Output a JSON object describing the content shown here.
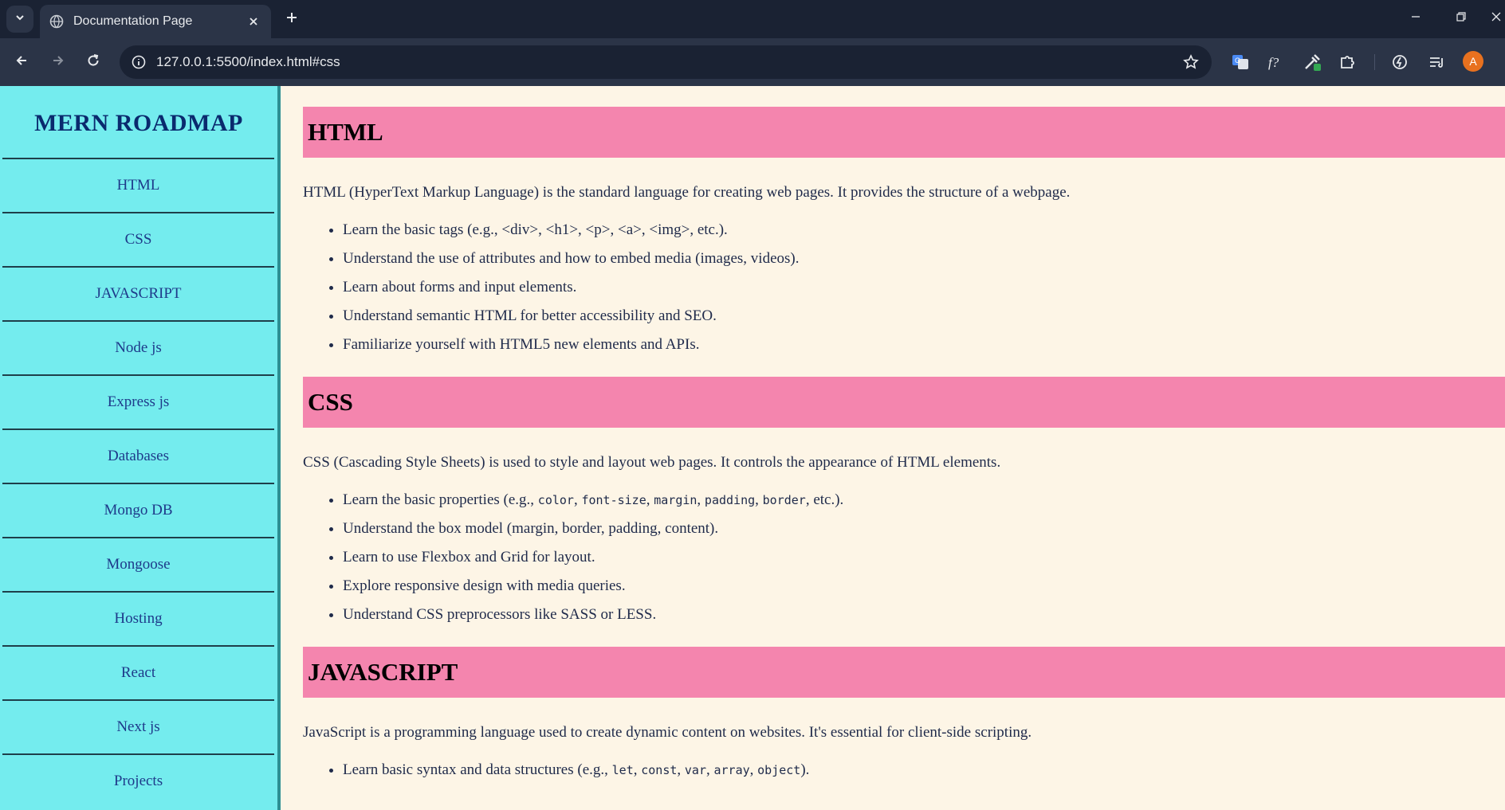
{
  "browser": {
    "tab_title": "Documentation Page",
    "url": "127.0.0.1:5500/index.html#css",
    "avatar_letter": "A",
    "accent_color": "#e8711f"
  },
  "sidebar": {
    "brand": "MERN ROADMAP",
    "items": [
      {
        "label": "HTML"
      },
      {
        "label": "CSS"
      },
      {
        "label": "JAVASCRIPT"
      },
      {
        "label": "Node js"
      },
      {
        "label": "Express js"
      },
      {
        "label": "Databases"
      },
      {
        "label": "Mongo DB"
      },
      {
        "label": "Mongoose"
      },
      {
        "label": "Hosting"
      },
      {
        "label": "React"
      },
      {
        "label": "Next js"
      },
      {
        "label": "Projects"
      }
    ]
  },
  "sections": [
    {
      "title": "HTML",
      "lead": "HTML (HyperText Markup Language) is the standard language for creating web pages. It provides the structure of a webpage.",
      "bullets": [
        "Learn the basic tags (e.g., <div>, <h1>, <p>, <a>, <img>, etc.).",
        "Understand the use of attributes and how to embed media (images, videos).",
        "Learn about forms and input elements.",
        "Understand semantic HTML for better accessibility and SEO.",
        "Familiarize yourself with HTML5 new elements and APIs."
      ]
    },
    {
      "title": "CSS",
      "lead": "CSS (Cascading Style Sheets) is used to style and layout web pages. It controls the appearance of HTML elements.",
      "bullet_props": {
        "prefix": "Learn the basic properties (e.g., ",
        "codes": [
          "color",
          "font-size",
          "margin",
          "padding",
          "border"
        ],
        "suffix": ", etc.)."
      },
      "bullets": [
        "Understand the box model (margin, border, padding, content).",
        "Learn to use Flexbox and Grid for layout.",
        "Explore responsive design with media queries.",
        "Understand CSS preprocessors like SASS or LESS."
      ]
    },
    {
      "title": "JAVASCRIPT",
      "lead": "JavaScript is a programming language used to create dynamic content on websites. It's essential for client-side scripting.",
      "bullet_syntax": {
        "prefix": "Learn basic syntax and data structures (e.g., ",
        "codes": [
          "let",
          "const",
          "var",
          "array",
          "object"
        ],
        "suffix": ")."
      }
    }
  ]
}
